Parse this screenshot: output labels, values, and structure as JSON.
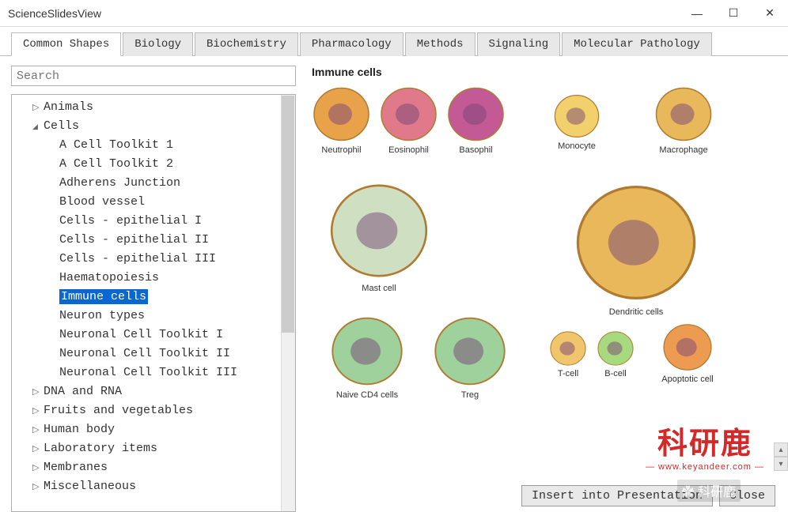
{
  "window": {
    "title": "ScienceSlidesView"
  },
  "tabs": [
    {
      "label": "Common Shapes",
      "active": true
    },
    {
      "label": "Biology",
      "active": false
    },
    {
      "label": "Biochemistry",
      "active": false
    },
    {
      "label": "Pharmacology",
      "active": false
    },
    {
      "label": "Methods",
      "active": false
    },
    {
      "label": "Signaling",
      "active": false
    },
    {
      "label": "Molecular Pathology",
      "active": false
    }
  ],
  "search": {
    "placeholder": "Search"
  },
  "tree": [
    {
      "label": "Animals",
      "level": 1,
      "arrow": "▷",
      "selected": false
    },
    {
      "label": "Cells",
      "level": 1,
      "arrow": "▲",
      "selected": false
    },
    {
      "label": "A Cell Toolkit 1",
      "level": 2,
      "arrow": "",
      "selected": false
    },
    {
      "label": "A Cell Toolkit 2",
      "level": 2,
      "arrow": "",
      "selected": false
    },
    {
      "label": "Adherens Junction",
      "level": 2,
      "arrow": "",
      "selected": false
    },
    {
      "label": "Blood vessel",
      "level": 2,
      "arrow": "",
      "selected": false
    },
    {
      "label": "Cells - epithelial I",
      "level": 2,
      "arrow": "",
      "selected": false
    },
    {
      "label": "Cells - epithelial II",
      "level": 2,
      "arrow": "",
      "selected": false
    },
    {
      "label": "Cells - epithelial III",
      "level": 2,
      "arrow": "",
      "selected": false
    },
    {
      "label": "Haematopoiesis",
      "level": 2,
      "arrow": "",
      "selected": false
    },
    {
      "label": "Immune cells",
      "level": 2,
      "arrow": "",
      "selected": true
    },
    {
      "label": "Neuron types",
      "level": 2,
      "arrow": "",
      "selected": false
    },
    {
      "label": "Neuronal Cell Toolkit I",
      "level": 2,
      "arrow": "",
      "selected": false
    },
    {
      "label": "Neuronal Cell Toolkit II",
      "level": 2,
      "arrow": "",
      "selected": false
    },
    {
      "label": "Neuronal Cell Toolkit III",
      "level": 2,
      "arrow": "",
      "selected": false
    },
    {
      "label": "DNA and RNA",
      "level": 1,
      "arrow": "▷",
      "selected": false
    },
    {
      "label": "Fruits and vegetables",
      "level": 1,
      "arrow": "▷",
      "selected": false
    },
    {
      "label": "Human body",
      "level": 1,
      "arrow": "▷",
      "selected": false
    },
    {
      "label": "Laboratory items",
      "level": 1,
      "arrow": "▷",
      "selected": false
    },
    {
      "label": "Membranes",
      "level": 1,
      "arrow": "▷",
      "selected": false
    },
    {
      "label": "Miscellaneous",
      "level": 1,
      "arrow": "▷",
      "selected": false
    }
  ],
  "preview": {
    "title": "Immune cells",
    "items": [
      {
        "label": "Neutrophil"
      },
      {
        "label": "Eosinophil"
      },
      {
        "label": "Basophil"
      },
      {
        "label": "Monocyte"
      },
      {
        "label": "Macrophage"
      },
      {
        "label": "Mast cell"
      },
      {
        "label": "Dendritic cells"
      },
      {
        "label": "Naive CD4 cells"
      },
      {
        "label": "Treg"
      },
      {
        "label": "T-cell"
      },
      {
        "label": "B-cell"
      },
      {
        "label": "Apoptotic cell"
      }
    ]
  },
  "buttons": {
    "insert": "Insert into Presentation",
    "close": "Close"
  },
  "watermark": {
    "main": "科研鹿",
    "sub": "— www.keyandeer.com —",
    "small": "科研鹿"
  }
}
